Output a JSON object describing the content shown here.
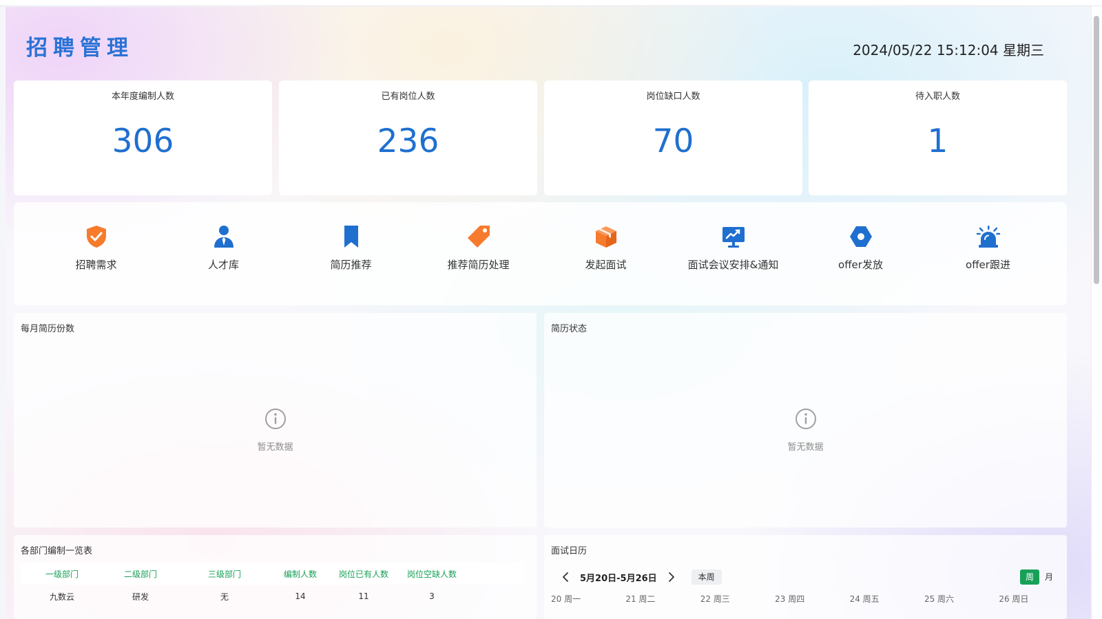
{
  "header": {
    "title": "招聘管理",
    "datetime": "2024/05/22 15:12:04 星期三"
  },
  "stats": [
    {
      "label": "本年度编制人数",
      "value": "306"
    },
    {
      "label": "已有岗位人数",
      "value": "236"
    },
    {
      "label": "岗位缺口人数",
      "value": "70"
    },
    {
      "label": "待入职人数",
      "value": "1"
    }
  ],
  "actions": [
    {
      "label": "招聘需求",
      "icon": "shield-check-icon",
      "color": "#f77b2d"
    },
    {
      "label": "人才库",
      "icon": "user-tie-icon",
      "color": "#1f6fcf"
    },
    {
      "label": "简历推荐",
      "icon": "bookmark-icon",
      "color": "#1f6fcf"
    },
    {
      "label": "推荐简历处理",
      "icon": "tag-icon",
      "color": "#f77b2d"
    },
    {
      "label": "发起面试",
      "icon": "box-icon",
      "color": "#f77b2d"
    },
    {
      "label": "面试会议安排&通知",
      "icon": "presentation-icon",
      "color": "#1f6fcf"
    },
    {
      "label": "offer发放",
      "icon": "hexagon-icon",
      "color": "#1f6fcf"
    },
    {
      "label": "offer跟进",
      "icon": "alarm-icon",
      "color": "#1f6fcf"
    }
  ],
  "monthly_resumes": {
    "title": "每月简历份数",
    "empty_text": "暂无数据"
  },
  "resume_status": {
    "title": "简历状态",
    "empty_text": "暂无数据"
  },
  "dept_table": {
    "title": "各部门编制一览表",
    "columns": [
      "一级部门",
      "二级部门",
      "三级部门",
      "编制人数",
      "岗位已有人数",
      "岗位空缺人数"
    ],
    "rows": [
      [
        "九数云",
        "研发",
        "无",
        "14",
        "11",
        "3"
      ]
    ]
  },
  "interview_calendar": {
    "title": "面试日历",
    "range": "5月20日-5月26日",
    "today_label": "本周",
    "mode_week": "周",
    "mode_month": "月",
    "days": [
      "20 周一",
      "21 周二",
      "22 周三",
      "23 周四",
      "24 周五",
      "25 周六",
      "26 周日"
    ]
  },
  "colors": {
    "primary_blue": "#1f6fcf",
    "accent_orange": "#f77b2d",
    "table_header_green": "#18a058"
  }
}
